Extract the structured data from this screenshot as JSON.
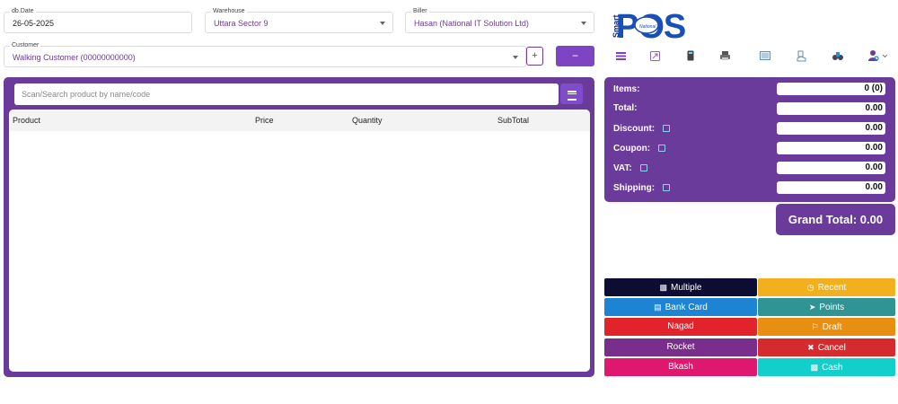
{
  "header": {
    "date": {
      "label": "db.Date",
      "value": "26-05-2025"
    },
    "warehouse": {
      "label": "Warehouse",
      "value": "Uttara Sector 9"
    },
    "biller": {
      "label": "Biller",
      "value": "Hasan (National IT Solution Ltd)"
    },
    "customer": {
      "label": "Customer",
      "value": "Walking Customer (00000000000)"
    },
    "add_customer_label": "+",
    "minus_label": "−"
  },
  "search": {
    "placeholder": "Scan/Search product by name/code"
  },
  "table": {
    "columns": [
      "Product",
      "Price",
      "Quantity",
      "SubTotal"
    ],
    "rows": []
  },
  "logo": {
    "text": "POS",
    "side_text": "Smart",
    "badge": "National"
  },
  "icons": [
    "menu-icon",
    "fullscreen-icon",
    "calculator-icon",
    "printer-icon",
    "report-icon",
    "register-icon",
    "binoculars-icon",
    "user-settings-icon"
  ],
  "summary": {
    "items_label": "Items:",
    "items_value": "0 (0)",
    "total_label": "Total:",
    "total_value": "0.00",
    "discount_label": "Discount:",
    "discount_value": "0.00",
    "coupon_label": "Coupon:",
    "coupon_value": "0.00",
    "vat_label": "VAT:",
    "vat_value": "0.00",
    "shipping_label": "Shipping:",
    "shipping_value": "0.00",
    "grand_total": "Grand Total: 0.00"
  },
  "payments": {
    "multiple": "Multiple",
    "recent": "Recent",
    "bank_card": "Bank Card",
    "points": "Points",
    "nagad": "Nagad",
    "draft": "Draft",
    "rocket": "Rocket",
    "cancel": "Cancel",
    "bkash": "Bkash",
    "cash": "Cash"
  },
  "colors": {
    "primary": "#6b3b9b",
    "multiple": "#0d0d33",
    "recent": "#f2b01e",
    "bank_card": "#1d84d4",
    "points": "#2f9493",
    "nagad": "#e1232b",
    "draft": "#e88f12",
    "rocket": "#7a2e8c",
    "cancel": "#d52b2f",
    "bkash": "#e0176e",
    "cash": "#13cfcb"
  }
}
